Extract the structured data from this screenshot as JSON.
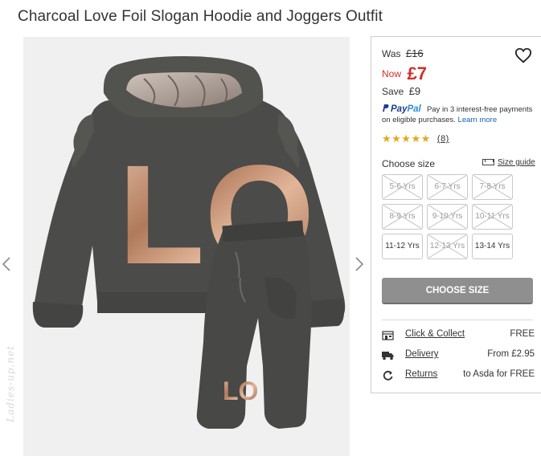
{
  "product": {
    "title": "Charcoal Love Foil Slogan Hoodie and Joggers Outfit"
  },
  "gallery": {
    "prev_icon": "chevron-left-icon",
    "next_icon": "chevron-right-icon",
    "watermark": "Ladies-up.net",
    "hoodie_text": "LO",
    "joggers_text": "LO"
  },
  "pricing": {
    "was_label": "Was",
    "was_value": "£16",
    "now_label": "Now",
    "now_value": "£7",
    "save_label": "Save",
    "save_value": "£9"
  },
  "paypal": {
    "logo_pay": "Pay",
    "logo_pal": "Pal",
    "message": "Pay in 3 interest-free payments on eligible purchases.",
    "link": "Learn more"
  },
  "rating": {
    "stars": "★★★★★",
    "value": 5,
    "count": "(8)"
  },
  "size": {
    "label": "Choose size",
    "guide_label": "Size guide",
    "options": [
      {
        "label": "5-6 Yrs",
        "available": false
      },
      {
        "label": "6-7 Yrs",
        "available": false
      },
      {
        "label": "7-8 Yrs",
        "available": false
      },
      {
        "label": "8-9 Yrs",
        "available": false
      },
      {
        "label": "9-10 Yrs",
        "available": false
      },
      {
        "label": "10-11 Yrs",
        "available": false
      },
      {
        "label": "11-12 Yrs",
        "available": true
      },
      {
        "label": "12-13 Yrs",
        "available": false
      },
      {
        "label": "13-14 Yrs",
        "available": true
      }
    ],
    "button_label": "CHOOSE SIZE"
  },
  "delivery": [
    {
      "icon": "store-icon",
      "label": "Click & Collect",
      "value": "FREE"
    },
    {
      "icon": "truck-icon",
      "label": "Delivery",
      "value": "From £2.95"
    },
    {
      "icon": "returns-icon",
      "label": "Returns",
      "value": "to Asda for FREE"
    }
  ],
  "colors": {
    "price_red": "#d0302a",
    "button_grey": "#8f8f8f",
    "star_gold": "#e3a81b",
    "link_blue": "#1565b5",
    "garment_charcoal": "#4a4a48",
    "foil_copper": "#c89a7c"
  }
}
